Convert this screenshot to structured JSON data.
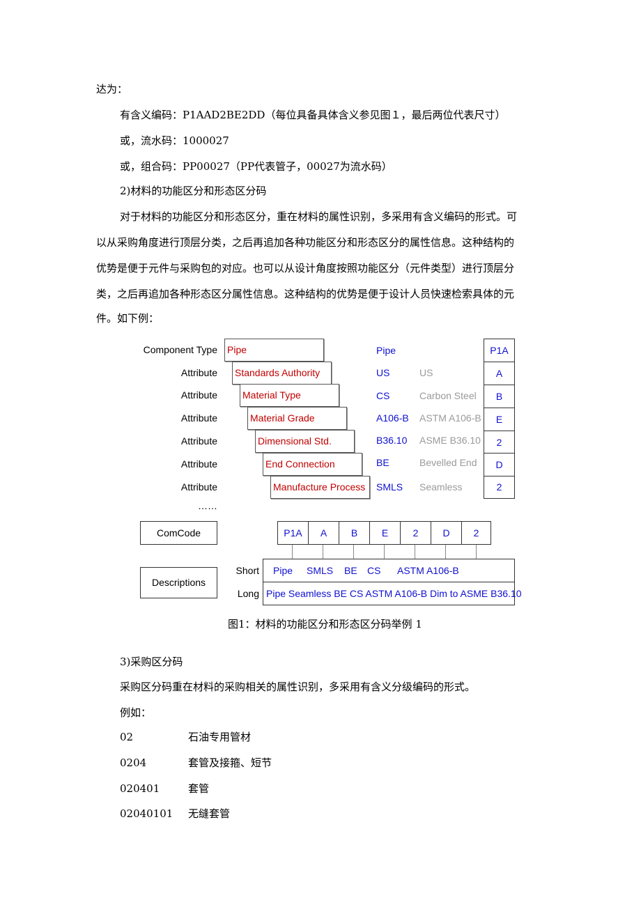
{
  "paragraphs": {
    "l1": "达为：",
    "l2": "有含义编码：P1AAD2BE2DD（每位具备具体含义参见图１，最后两位代表尺寸）",
    "l3": "或，流水码：1000027",
    "l4": "或，组合码：PP00027（PP代表管子，00027为流水码）",
    "l5": "2)材料的功能区分和形态区分码",
    "body": [
      "对于材料的功能区分和形态区分，重在材料的属性识别，多采用有含义编码的形式。可",
      "以从采购角度进行顶层分类，之后再追加各种功能区分和形态区分的属性信息。这种结构的",
      "优势是便于元件与采购包的对应。也可以从设计角度按照功能区分（元件类型）进行顶层分",
      "类，之后再追加各种形态区分属性信息。这种结构的优势是便于设计人员快速检索具体的元",
      "件。如下例："
    ]
  },
  "figure": {
    "rows": [
      {
        "label": "Component Type",
        "box": "Pipe",
        "abbr": "Pipe",
        "desc": "",
        "code": "P1A"
      },
      {
        "label": "Attribute",
        "box": "Standards Authority",
        "abbr": "US",
        "desc": "US",
        "code": "A"
      },
      {
        "label": "Attribute",
        "box": "Material Type",
        "abbr": "CS",
        "desc": "Carbon Steel",
        "code": "B"
      },
      {
        "label": "Attribute",
        "box": "Material Grade",
        "abbr": "A106-B",
        "desc": "ASTM A106-B",
        "code": "E"
      },
      {
        "label": "Attribute",
        "box": "Dimensional Std.",
        "abbr": "B36.10",
        "desc": "ASME B36.10",
        "code": "2"
      },
      {
        "label": "Attribute",
        "box": "End Connection",
        "abbr": "BE",
        "desc": "Bevelled End",
        "code": "D"
      },
      {
        "label": "Attribute",
        "box": "Manufacture Process",
        "abbr": "SMLS",
        "desc": "Seamless",
        "code": "2"
      }
    ],
    "ellipsis": "……",
    "comcode_label": "ComCode",
    "comcode_cells": [
      "P1A",
      "A",
      "B",
      "E",
      "2",
      "D",
      "2"
    ],
    "descriptions_label": "Descriptions",
    "short_label": "Short",
    "long_label": "Long",
    "short_items": [
      "Pipe",
      "SMLS",
      "BE",
      "CS",
      "ASTM A106-B"
    ],
    "long_text": "Pipe Seamless BE CS ASTM A106-B Dim to ASME B36.10",
    "caption": "图1：材料的功能区分和形态区分码举例 1"
  },
  "section3": {
    "heading": "3)采购区分码",
    "text": "采购区分码重在材料的采购相关的属性识别，多采用有含义分级编码的形式。",
    "example": "例如：",
    "codes": [
      {
        "code": "02",
        "name": "石油专用管材"
      },
      {
        "code": "0204",
        "name": "套管及接箍、短节"
      },
      {
        "code": "020401",
        "name": "套管"
      },
      {
        "code": "02040101",
        "name": "无缝套管"
      }
    ]
  }
}
